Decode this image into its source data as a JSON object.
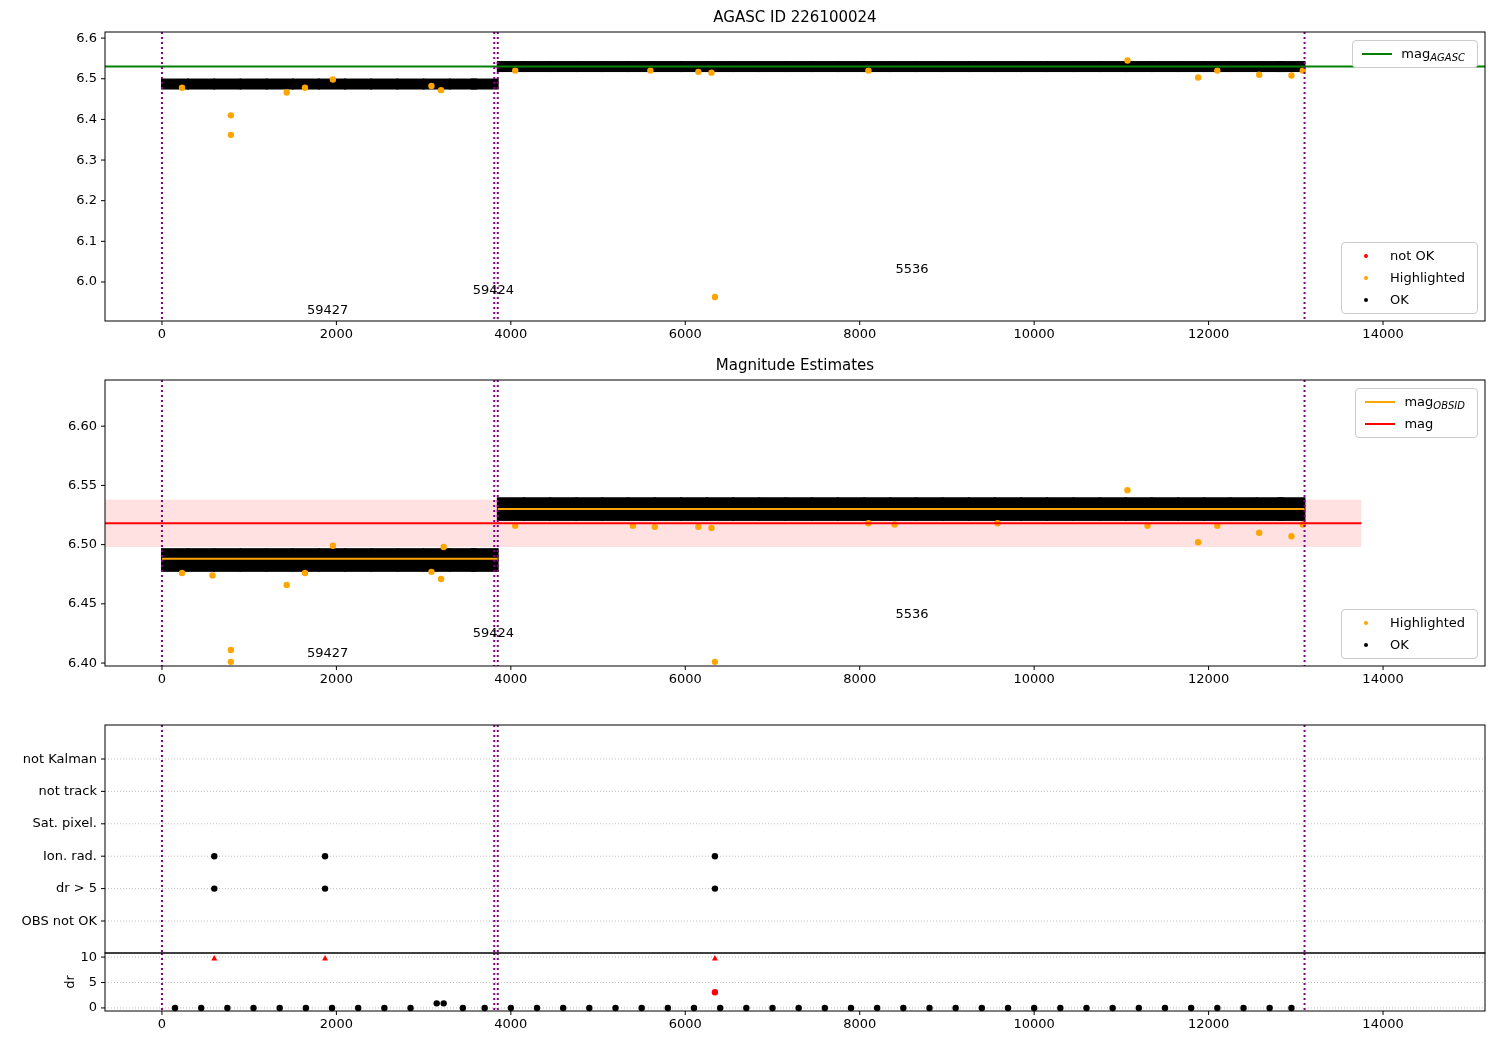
{
  "panels": [
    {
      "chart_data": {
        "type": "scatter",
        "title": "AGASC ID 226100024",
        "xlim": [
          -653,
          15169
        ],
        "ylim": [
          5.904,
          6.615
        ],
        "xticks": [
          0,
          2000,
          4000,
          6000,
          8000,
          10000,
          12000,
          14000
        ],
        "yticks": [
          {
            "value": 6.0,
            "label": "6.0"
          },
          {
            "value": 6.1,
            "label": "6.1"
          },
          {
            "value": 6.2,
            "label": "6.2"
          },
          {
            "value": 6.3,
            "label": "6.3"
          },
          {
            "value": 6.4,
            "label": "6.4"
          },
          {
            "value": 6.5,
            "label": "6.5"
          },
          {
            "value": 6.6,
            "label": "6.6"
          }
        ],
        "series": [
          {
            "color": "#000000",
            "marker": "square",
            "x": [
              150,
              450,
              750,
              1050,
              1350,
              1650,
              1950,
              2250,
              2550,
              2850,
              3150,
              3450,
              3700,
              4000,
              4300,
              4600,
              4900,
              5200,
              5500,
              5800,
              6100,
              6400,
              6700,
              7000,
              7300,
              7600,
              7900,
              8200,
              8500,
              8800,
              9100,
              9400,
              9700,
              10000,
              10300,
              10600,
              10900,
              11200,
              11500,
              11800,
              12100,
              12400,
              12700,
              12950
            ],
            "values": [
              6.487,
              6.487,
              6.487,
              6.487,
              6.487,
              6.487,
              6.487,
              6.487,
              6.487,
              6.487,
              6.487,
              6.487,
              6.487,
              6.53,
              6.53,
              6.53,
              6.53,
              6.53,
              6.53,
              6.53,
              6.53,
              6.53,
              6.53,
              6.53,
              6.53,
              6.53,
              6.53,
              6.53,
              6.53,
              6.53,
              6.53,
              6.53,
              6.53,
              6.53,
              6.53,
              6.53,
              6.53,
              6.53,
              6.53,
              6.53,
              6.53,
              6.53,
              6.53,
              6.53
            ]
          },
          {
            "color": "#ffa500",
            "marker": "circle",
            "x": [
              230,
              790,
              790,
              1430,
              1640,
              1960,
              3090,
              3200,
              4050,
              5600,
              6150,
              6300,
              6340,
              8100,
              11070,
              11880,
              12100,
              12580,
              12950,
              13080
            ],
            "values": [
              6.478,
              6.41,
              6.362,
              6.466,
              6.478,
              6.498,
              6.482,
              6.472,
              6.52,
              6.52,
              6.517,
              6.515,
              5.963,
              6.52,
              6.545,
              6.503,
              6.52,
              6.51,
              6.508,
              6.52
            ]
          },
          {
            "type": "line",
            "color": "#008000",
            "x": [
              -653,
              15169
            ],
            "values": [
              6.53,
              6.53
            ]
          }
        ],
        "ref_lines": [
          {
            "axis": "x",
            "value": 0,
            "color": "#800080"
          },
          {
            "axis": "x",
            "value": 3810,
            "color": "#800080"
          },
          {
            "axis": "x",
            "value": 3850,
            "color": "#800080"
          },
          {
            "axis": "x",
            "value": 13100,
            "color": "#800080"
          }
        ],
        "annotations": [
          "59427",
          "59424",
          "5536"
        ]
      },
      "legends": [
        {
          "entries": [
            {
              "label": "mag$_{AGASC}$",
              "kind": "line",
              "color": "#008000"
            }
          ]
        },
        {
          "entries": [
            {
              "label": "not OK",
              "kind": "dot",
              "color": "#ff0000"
            },
            {
              "label": "Highlighted",
              "kind": "dot",
              "color": "#ffa500"
            },
            {
              "label": "OK",
              "kind": "dot",
              "color": "#000000"
            }
          ]
        }
      ]
    },
    {
      "chart_data": {
        "type": "scatter",
        "title": "Magnitude Estimates",
        "xlim": [
          -653,
          15169
        ],
        "ylim": [
          6.3975,
          6.639
        ],
        "xticks": [
          0,
          2000,
          4000,
          6000,
          8000,
          10000,
          12000,
          14000
        ],
        "yticks": [
          {
            "value": 6.4,
            "label": "6.40"
          },
          {
            "value": 6.45,
            "label": "6.45"
          },
          {
            "value": 6.5,
            "label": "6.50"
          },
          {
            "value": 6.55,
            "label": "6.55"
          },
          {
            "value": 6.6,
            "label": "6.60"
          }
        ],
        "series": [
          {
            "color": "#000000",
            "marker": "square",
            "x": [
              150,
              450,
              750,
              1050,
              1350,
              1650,
              1950,
              2250,
              2550,
              2850,
              3150,
              3450,
              3700,
              4000,
              4300,
              4600,
              4900,
              5200,
              5500,
              5800,
              6100,
              6400,
              6700,
              7000,
              7300,
              7600,
              7900,
              8200,
              8500,
              8800,
              9100,
              9400,
              9700,
              10000,
              10300,
              10600,
              10900,
              11200,
              11500,
              11800,
              12100,
              12400,
              12700,
              12950
            ],
            "values": [
              6.487,
              6.487,
              6.487,
              6.487,
              6.487,
              6.487,
              6.487,
              6.487,
              6.487,
              6.487,
              6.487,
              6.487,
              6.487,
              6.53,
              6.53,
              6.53,
              6.53,
              6.53,
              6.53,
              6.53,
              6.53,
              6.53,
              6.53,
              6.53,
              6.53,
              6.53,
              6.53,
              6.53,
              6.53,
              6.53,
              6.53,
              6.53,
              6.53,
              6.53,
              6.53,
              6.53,
              6.53,
              6.53,
              6.53,
              6.53,
              6.53,
              6.53,
              6.53,
              6.53
            ]
          },
          {
            "color": "#ffa500",
            "marker": "circle",
            "x": [
              230,
              580,
              790,
              790,
              1430,
              1640,
              1960,
              3090,
              3200,
              3230,
              4050,
              5400,
              5650,
              6150,
              6300,
              6340,
              8100,
              8400,
              9580,
              11070,
              11300,
              11880,
              12100,
              12580,
              12950,
              13080
            ],
            "values": [
              6.476,
              6.474,
              6.411,
              6.401,
              6.466,
              6.476,
              6.499,
              6.477,
              6.471,
              6.498,
              6.516,
              6.516,
              6.515,
              6.515,
              6.514,
              6.401,
              6.518,
              6.517,
              6.518,
              6.546,
              6.516,
              6.502,
              6.516,
              6.51,
              6.507,
              6.517
            ]
          },
          {
            "type": "line",
            "color": "#ffa500",
            "x": [
              0,
              3850,
              null,
              3850,
              13100
            ],
            "values": [
              6.488,
              6.488,
              null,
              6.53,
              6.53
            ]
          },
          {
            "type": "line",
            "color": "#ff0000",
            "x": [
              -653,
              13750
            ],
            "values": [
              6.518,
              6.518
            ]
          }
        ],
        "bands": [
          {
            "axis": "y",
            "from": 6.498,
            "to": 6.538,
            "color": "#ffe1e1"
          }
        ],
        "ref_lines": [
          {
            "axis": "x",
            "value": 0,
            "color": "#800080"
          },
          {
            "axis": "x",
            "value": 3810,
            "color": "#800080"
          },
          {
            "axis": "x",
            "value": 3850,
            "color": "#800080"
          },
          {
            "axis": "x",
            "value": 13100,
            "color": "#800080"
          }
        ],
        "annotations": [
          "59427",
          "59424",
          "5536"
        ]
      },
      "legends": [
        {
          "entries": [
            {
              "label": "mag$_{OBSID}$",
              "kind": "line",
              "color": "#ffa500"
            },
            {
              "label": "mag",
              "kind": "line",
              "color": "#ff0000"
            }
          ]
        },
        {
          "entries": [
            {
              "label": "Highlighted",
              "kind": "dot",
              "color": "#ffa500"
            },
            {
              "label": "OK",
              "kind": "dot",
              "color": "#000000"
            }
          ]
        }
      ]
    },
    {
      "chart_data": {
        "type": "scatter",
        "xlim": [
          -653,
          15169
        ],
        "grid": true,
        "orientation": "horizontal",
        "categories": [
          "not Kalman",
          "not track",
          "Sat. pixel.",
          "Ion. rad.",
          "dr > 5",
          "OBS not OK"
        ],
        "series": [
          {
            "color": "#000000",
            "marker": "circle",
            "values": [
              null,
              null,
              null,
              600,
              600,
              null
            ]
          },
          {
            "color": "#000000",
            "marker": "circle",
            "values": [
              null,
              null,
              null,
              1870,
              1870,
              null
            ]
          },
          {
            "color": "#000000",
            "marker": "circle",
            "values": [
              null,
              null,
              null,
              6340,
              6340,
              null
            ]
          }
        ],
        "ref_lines": [
          {
            "axis": "x",
            "value": 0,
            "color": "#800080"
          },
          {
            "axis": "x",
            "value": 3810,
            "color": "#800080"
          },
          {
            "axis": "x",
            "value": 3850,
            "color": "#800080"
          },
          {
            "axis": "x",
            "value": 13100,
            "color": "#800080"
          }
        ]
      }
    },
    {
      "chart_data": {
        "type": "scatter",
        "ylabel": "dr",
        "xlim": [
          -653,
          15169
        ],
        "ylim": [
          -0.6,
          10.8
        ],
        "grid": true,
        "xticks": [
          0,
          2000,
          4000,
          6000,
          8000,
          10000,
          12000,
          14000
        ],
        "yticks": [
          0,
          5,
          10
        ],
        "series": [
          {
            "color": "#000000",
            "marker": "circle",
            "x": [
              150,
              450,
              750,
              1050,
              1350,
              1650,
              1950,
              2250,
              2550,
              2850,
              3150,
              3230,
              3450,
              3700,
              4000,
              4300,
              4600,
              4900,
              5200,
              5500,
              5800,
              6100,
              6400,
              6700,
              7000,
              7300,
              7600,
              7900,
              8200,
              8500,
              8800,
              9100,
              9400,
              9700,
              10000,
              10300,
              10600,
              10900,
              11200,
              11500,
              11800,
              12100,
              12400,
              12700,
              12950
            ],
            "values": [
              0,
              0,
              0,
              0,
              0,
              0,
              0,
              0,
              0,
              0,
              0.9,
              0.9,
              0,
              0,
              0,
              0,
              0,
              0,
              0,
              0,
              0,
              0,
              0,
              0,
              0,
              0,
              0,
              0,
              0,
              0,
              0,
              0,
              0,
              0,
              0,
              0,
              0,
              0,
              0,
              0,
              0,
              0,
              0,
              0,
              0
            ]
          },
          {
            "color": "#ff0000",
            "marker": "triangle",
            "x": [
              600,
              1870,
              6340
            ],
            "values": [
              9.8,
              9.8,
              9.8
            ]
          },
          {
            "color": "#ff0000",
            "marker": "circle",
            "x": [
              6340
            ],
            "values": [
              3.1
            ]
          }
        ],
        "ref_lines": [
          {
            "axis": "x",
            "value": 0,
            "color": "#800080"
          },
          {
            "axis": "x",
            "value": 3810,
            "color": "#800080"
          },
          {
            "axis": "x",
            "value": 3850,
            "color": "#800080"
          },
          {
            "axis": "x",
            "value": 13100,
            "color": "#800080"
          }
        ]
      }
    }
  ]
}
